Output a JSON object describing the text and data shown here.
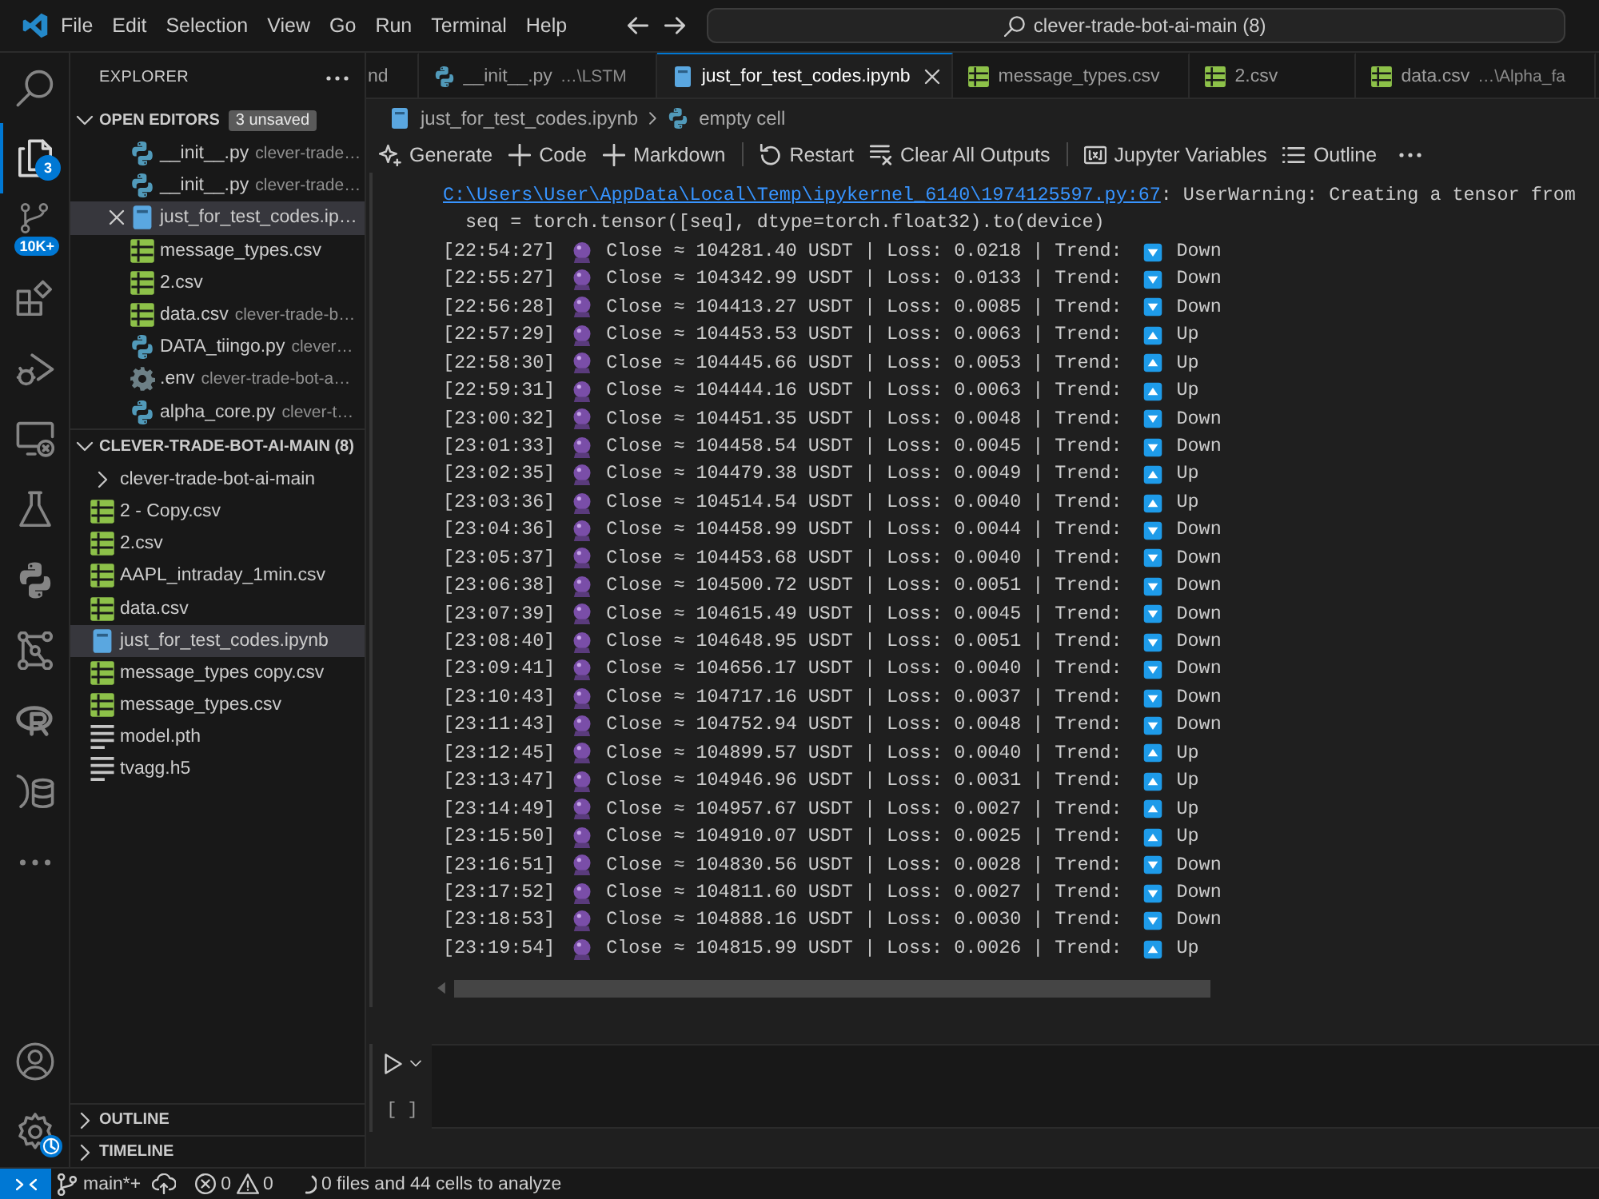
{
  "title_bar": {
    "menus": [
      "File",
      "Edit",
      "Selection",
      "View",
      "Go",
      "Run",
      "Terminal",
      "Help"
    ],
    "search": {
      "value": "clever-trade-bot-ai-main (8)"
    }
  },
  "activity_bar": {
    "items": [
      {
        "kind": "search",
        "selected": false
      },
      {
        "kind": "explorer",
        "selected": true,
        "badge": "3"
      },
      {
        "kind": "source-control",
        "selected": false,
        "badge": "10K+"
      },
      {
        "kind": "extensions",
        "selected": false
      },
      {
        "kind": "run-debug",
        "selected": false
      },
      {
        "kind": "remote",
        "selected": false
      },
      {
        "kind": "testing",
        "selected": false
      },
      {
        "kind": "python",
        "selected": false
      },
      {
        "kind": "graph",
        "selected": false
      },
      {
        "kind": "r",
        "selected": false
      },
      {
        "kind": "database",
        "selected": false
      },
      {
        "kind": "more",
        "selected": false
      }
    ],
    "bottom_items": [
      {
        "kind": "account"
      },
      {
        "kind": "settings"
      }
    ]
  },
  "sidebar": {
    "title": "EXPLORER",
    "open_editors": {
      "title": "OPEN EDITORS",
      "expanded": true,
      "badge": "3 unsaved",
      "items": [
        {
          "kind": "python",
          "name": "__init__.py",
          "description": "clever-trade…",
          "selected": false
        },
        {
          "kind": "python",
          "name": "__init__.py",
          "description": "clever-trade…",
          "selected": false
        },
        {
          "kind": "notebook",
          "name": "just_for_test_codes.ip…",
          "selected": true
        },
        {
          "kind": "csv",
          "name": "message_types.csv",
          "selected": false
        },
        {
          "kind": "csv",
          "name": "2.csv",
          "selected": false
        },
        {
          "kind": "csv",
          "name": "data.csv",
          "description": "clever-trade-b…",
          "selected": false
        },
        {
          "kind": "python",
          "name": "DATA_tiingo.py",
          "description": "clever…",
          "selected": false
        },
        {
          "kind": "gear",
          "name": ".env",
          "description": "clever-trade-bot-a…",
          "selected": false
        },
        {
          "kind": "python",
          "name": "alpha_core.py",
          "description": "clever-t…",
          "selected": false
        }
      ]
    },
    "folder": {
      "title": "CLEVER-TRADE-BOT-AI-MAIN (8)",
      "expanded": true,
      "children": [
        {
          "kind": "folder",
          "name": "clever-trade-bot-ai-main",
          "expanded": false,
          "selected": false
        },
        {
          "kind": "csv",
          "name": "2 - Copy.csv",
          "selected": false
        },
        {
          "kind": "csv",
          "name": "2.csv",
          "selected": false
        },
        {
          "kind": "csv",
          "name": "AAPL_intraday_1min.csv",
          "selected": false
        },
        {
          "kind": "csv",
          "name": "data.csv",
          "selected": false
        },
        {
          "kind": "notebook",
          "name": "just_for_test_codes.ipynb",
          "selected": true
        },
        {
          "kind": "csv",
          "name": "message_types copy.csv",
          "selected": false
        },
        {
          "kind": "csv",
          "name": "message_types.csv",
          "selected": false
        },
        {
          "kind": "file",
          "name": "model.pth",
          "selected": false
        },
        {
          "kind": "file",
          "name": "tvagg.h5",
          "selected": false
        }
      ]
    },
    "sections": [
      {
        "title": "OUTLINE",
        "expanded": false
      },
      {
        "title": "TIMELINE",
        "expanded": false
      }
    ]
  },
  "tabs": [
    {
      "label": "nd",
      "selected": false
    },
    {
      "kind": "python",
      "label": "__init__.py",
      "description": "…\\LSTM",
      "selected": false
    },
    {
      "kind": "notebook",
      "label": "just_for_test_codes.ipynb",
      "selected": true
    },
    {
      "kind": "csv",
      "label": "message_types.csv",
      "selected": false
    },
    {
      "kind": "csv",
      "label": "2.csv",
      "selected": false
    },
    {
      "kind": "csv",
      "label": "data.csv",
      "description": "…\\Alpha_fa",
      "selected": false
    }
  ],
  "breadcrumbs": [
    {
      "kind": "notebook",
      "label": "just_for_test_codes.ipynb"
    },
    {
      "kind": "python",
      "label": "empty cell"
    }
  ],
  "notebook_toolbar": [
    {
      "kind": "sparkle",
      "label": "Generate"
    },
    {
      "kind": "plus",
      "label": "Code"
    },
    {
      "kind": "plus",
      "label": "Markdown"
    },
    {
      "kind": "separator"
    },
    {
      "kind": "restart",
      "label": "Restart"
    },
    {
      "kind": "clear",
      "label": "Clear All Outputs"
    },
    {
      "kind": "separator"
    },
    {
      "kind": "variables",
      "label": "Jupyter Variables"
    },
    {
      "kind": "outline",
      "label": "Outline"
    },
    {
      "kind": "more"
    }
  ],
  "output": {
    "link": "C:\\Users\\User\\AppData\\Local\\Temp\\ipykernel_6140\\1974125597.py:67",
    "warning": ": UserWarning: Creating a tensor from",
    "code_line": "seq = torch.tensor([seq], dtype=torch.float32).to(device)",
    "rows": [
      {
        "time": "[22:54:27]",
        "message": "Close ≈ 104281.40 USDT | Loss: 0.0218 | Trend:",
        "kind": "down",
        "trend": "Down"
      },
      {
        "time": "[22:55:27]",
        "message": "Close ≈ 104342.99 USDT | Loss: 0.0133 | Trend:",
        "kind": "down",
        "trend": "Down"
      },
      {
        "time": "[22:56:28]",
        "message": "Close ≈ 104413.27 USDT | Loss: 0.0085 | Trend:",
        "kind": "down",
        "trend": "Down"
      },
      {
        "time": "[22:57:29]",
        "message": "Close ≈ 104453.53 USDT | Loss: 0.0063 | Trend:",
        "kind": "up",
        "trend": "Up"
      },
      {
        "time": "[22:58:30]",
        "message": "Close ≈ 104445.66 USDT | Loss: 0.0053 | Trend:",
        "kind": "up",
        "trend": "Up"
      },
      {
        "time": "[22:59:31]",
        "message": "Close ≈ 104444.16 USDT | Loss: 0.0063 | Trend:",
        "kind": "up",
        "trend": "Up"
      },
      {
        "time": "[23:00:32]",
        "message": "Close ≈ 104451.35 USDT | Loss: 0.0048 | Trend:",
        "kind": "down",
        "trend": "Down"
      },
      {
        "time": "[23:01:33]",
        "message": "Close ≈ 104458.54 USDT | Loss: 0.0045 | Trend:",
        "kind": "down",
        "trend": "Down"
      },
      {
        "time": "[23:02:35]",
        "message": "Close ≈ 104479.38 USDT | Loss: 0.0049 | Trend:",
        "kind": "up",
        "trend": "Up"
      },
      {
        "time": "[23:03:36]",
        "message": "Close ≈ 104514.54 USDT | Loss: 0.0040 | Trend:",
        "kind": "up",
        "trend": "Up"
      },
      {
        "time": "[23:04:36]",
        "message": "Close ≈ 104458.99 USDT | Loss: 0.0044 | Trend:",
        "kind": "down",
        "trend": "Down"
      },
      {
        "time": "[23:05:37]",
        "message": "Close ≈ 104453.68 USDT | Loss: 0.0040 | Trend:",
        "kind": "down",
        "trend": "Down"
      },
      {
        "time": "[23:06:38]",
        "message": "Close ≈ 104500.72 USDT | Loss: 0.0051 | Trend:",
        "kind": "down",
        "trend": "Down"
      },
      {
        "time": "[23:07:39]",
        "message": "Close ≈ 104615.49 USDT | Loss: 0.0045 | Trend:",
        "kind": "down",
        "trend": "Down"
      },
      {
        "time": "[23:08:40]",
        "message": "Close ≈ 104648.95 USDT | Loss: 0.0051 | Trend:",
        "kind": "down",
        "trend": "Down"
      },
      {
        "time": "[23:09:41]",
        "message": "Close ≈ 104656.17 USDT | Loss: 0.0040 | Trend:",
        "kind": "down",
        "trend": "Down"
      },
      {
        "time": "[23:10:43]",
        "message": "Close ≈ 104717.16 USDT | Loss: 0.0037 | Trend:",
        "kind": "down",
        "trend": "Down"
      },
      {
        "time": "[23:11:43]",
        "message": "Close ≈ 104752.94 USDT | Loss: 0.0048 | Trend:",
        "kind": "down",
        "trend": "Down"
      },
      {
        "time": "[23:12:45]",
        "message": "Close ≈ 104899.57 USDT | Loss: 0.0040 | Trend:",
        "kind": "up",
        "trend": "Up"
      },
      {
        "time": "[23:13:47]",
        "message": "Close ≈ 104946.96 USDT | Loss: 0.0031 | Trend:",
        "kind": "up",
        "trend": "Up"
      },
      {
        "time": "[23:14:49]",
        "message": "Close ≈ 104957.67 USDT | Loss: 0.0027 | Trend:",
        "kind": "up",
        "trend": "Up"
      },
      {
        "time": "[23:15:50]",
        "message": "Close ≈ 104910.07 USDT | Loss: 0.0025 | Trend:",
        "kind": "up",
        "trend": "Up"
      },
      {
        "time": "[23:16:51]",
        "message": "Close ≈ 104830.56 USDT | Loss: 0.0028 | Trend:",
        "kind": "down",
        "trend": "Down"
      },
      {
        "time": "[23:17:52]",
        "message": "Close ≈ 104811.60 USDT | Loss: 0.0027 | Trend:",
        "kind": "down",
        "trend": "Down"
      },
      {
        "time": "[23:18:53]",
        "message": "Close ≈ 104888.16 USDT | Loss: 0.0030 | Trend:",
        "kind": "down",
        "trend": "Down"
      },
      {
        "time": "[23:19:54]",
        "message": "Close ≈ 104815.99 USDT | Loss: 0.0026 | Trend:",
        "kind": "up",
        "trend": "Up"
      }
    ]
  },
  "empty_cell": {
    "execution_label": "[ ]"
  },
  "status_bar": {
    "branch": "main*+",
    "errors": "0",
    "warnings": "0",
    "analysis": "0 files and 44 cells to analyze"
  }
}
